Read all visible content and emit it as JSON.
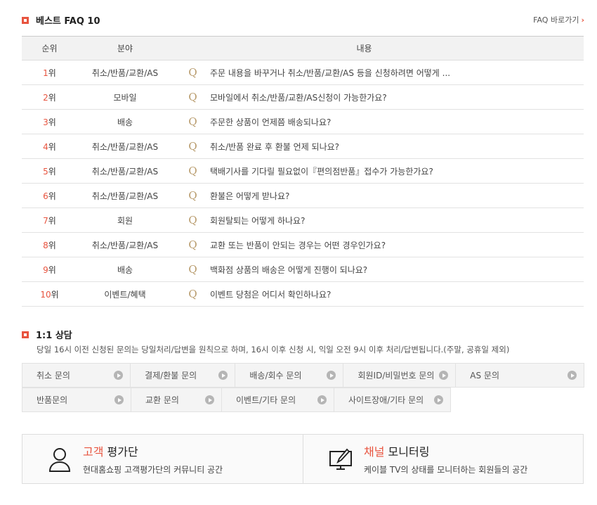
{
  "faq": {
    "title": "베스트 FAQ 10",
    "link_label": "FAQ 바로가기",
    "link_arrow": "›",
    "headers": {
      "rank": "순위",
      "category": "분야",
      "content": "내용"
    },
    "q_mark": "Q",
    "rank_suffix": "위",
    "rows": [
      {
        "rank": "1",
        "category": "취소/반품/교환/AS",
        "question": "주문 내용을 바꾸거나 취소/반품/교환/AS 등을 신청하려면 어떻게 ..."
      },
      {
        "rank": "2",
        "category": "모바일",
        "question": "모바일에서 취소/반품/교환/AS신청이 가능한가요?"
      },
      {
        "rank": "3",
        "category": "배송",
        "question": "주문한 상품이 언제쯤 배송되나요?"
      },
      {
        "rank": "4",
        "category": "취소/반품/교환/AS",
        "question": "취소/반품 완료 후 환불 언제 되나요?"
      },
      {
        "rank": "5",
        "category": "취소/반품/교환/AS",
        "question": "택배기사를 기다릴 필요없이『편의점반품』접수가 가능한가요?"
      },
      {
        "rank": "6",
        "category": "취소/반품/교환/AS",
        "question": "환불은 어떻게 받나요?"
      },
      {
        "rank": "7",
        "category": "회원",
        "question": "회원탈퇴는 어떻게 하나요?"
      },
      {
        "rank": "8",
        "category": "취소/반품/교환/AS",
        "question": "교환 또는 반품이 안되는 경우는 어떤 경우인가요?"
      },
      {
        "rank": "9",
        "category": "배송",
        "question": "백화점 상품의 배송은 어떻게 진행이 되나요?"
      },
      {
        "rank": "10",
        "category": "이벤트/혜택",
        "question": "이벤트 당첨은 어디서 확인하나요?"
      }
    ]
  },
  "consult": {
    "title": "1:1 상담",
    "notice": "당일 16시 이전 신청된 문의는 당일처리/답변을 원칙으로 하며, 16시 이후 신청 시, 익일 오전 9시 이후 처리/답변됩니다.(주말, 공휴일 제외)",
    "row1": [
      "취소 문의",
      "결제/환불 문의",
      "배송/회수 문의",
      "회원ID/비밀번호 문의",
      "AS 문의"
    ],
    "row2": [
      "반품문의",
      "교환 문의",
      "이벤트/기타 문의",
      "사이트장애/기타 문의"
    ]
  },
  "panels": {
    "evaluators": {
      "title_highlight": "고객",
      "title_rest": " 평가단",
      "desc": "현대홈쇼핑 고객평가단의 커뮤니티 공간",
      "icon": "person-icon"
    },
    "monitoring": {
      "title_highlight": "채널",
      "title_rest": " 모니터링",
      "desc": "케이블 TV의 상태를 모니터하는 회원들의 공간",
      "icon": "monitor-pen-icon"
    }
  },
  "colors": {
    "accent": "#e8543f",
    "q_mark": "#b89b6c"
  }
}
